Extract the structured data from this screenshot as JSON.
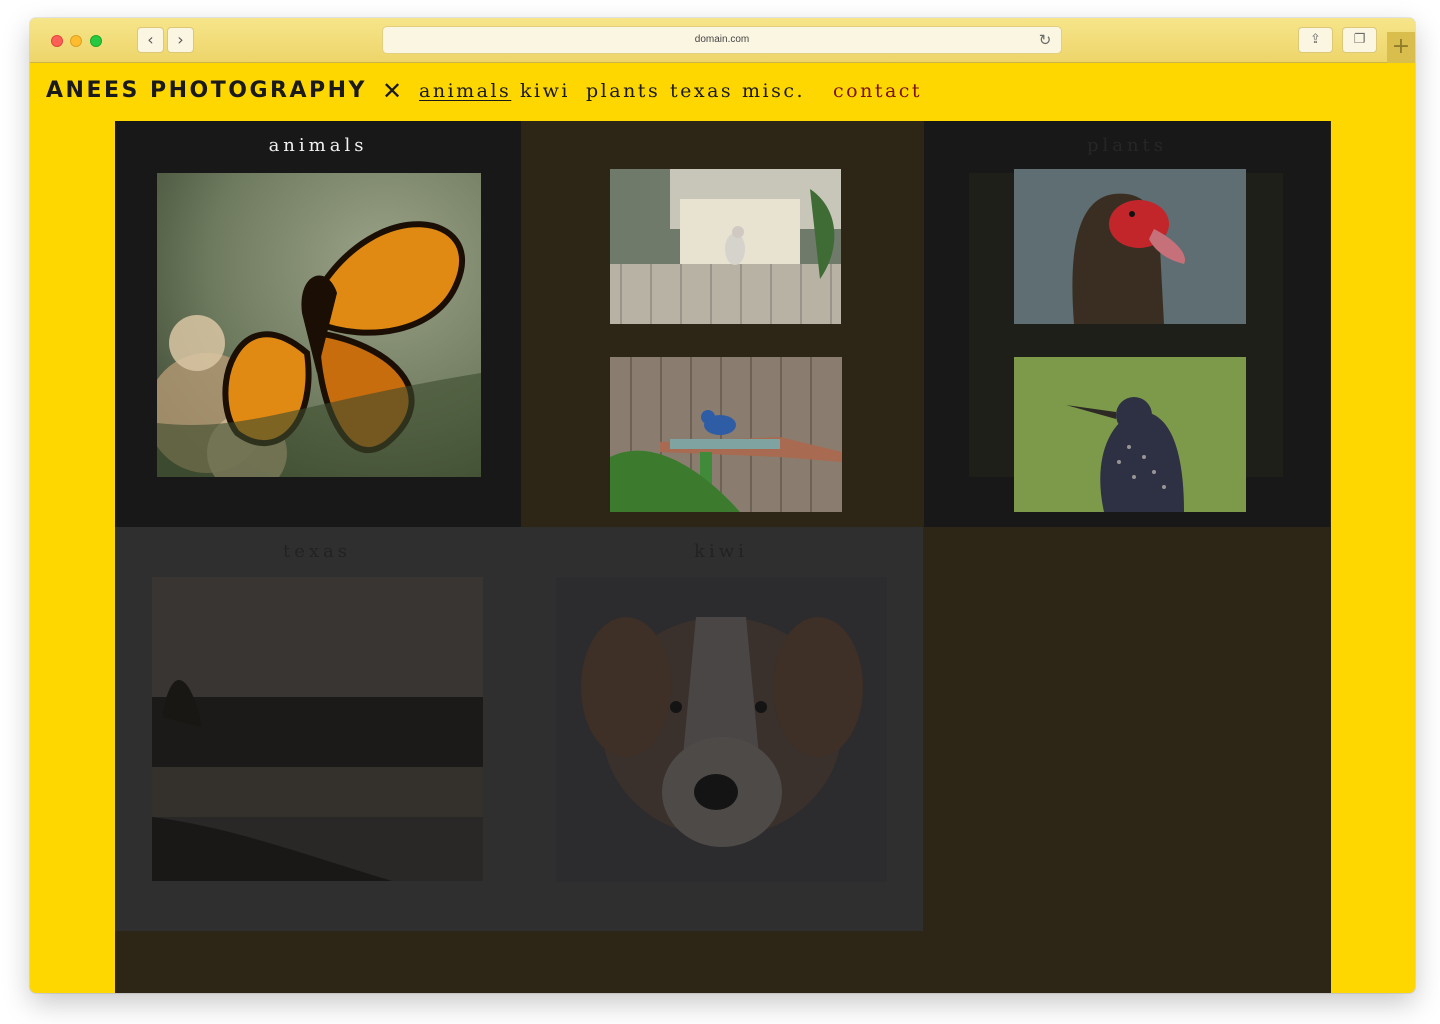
{
  "browser": {
    "url": "domain.com",
    "back_icon": "‹",
    "forward_icon": "›",
    "reload_icon": "↻",
    "share_icon": "⇪",
    "tabs_icon": "❐",
    "newtab_icon": "+"
  },
  "site": {
    "brand": "ANEES PHOTOGRAPHY",
    "close_icon": "✕",
    "menu": [
      {
        "label": "animals"
      },
      {
        "label": "kiwi"
      },
      {
        "label": "plants"
      },
      {
        "label": "texas"
      },
      {
        "label": "misc."
      },
      {
        "label": "contact"
      }
    ],
    "colors": {
      "background": "#FFD700",
      "gallery_bg": "#2D2616",
      "tile_dark": "#181818",
      "contact": "#7A1010"
    }
  },
  "gallery": {
    "tiles": [
      {
        "title": "animals"
      },
      {
        "title": "plants"
      },
      {
        "title": "texas"
      },
      {
        "title": "kiwi"
      }
    ]
  }
}
